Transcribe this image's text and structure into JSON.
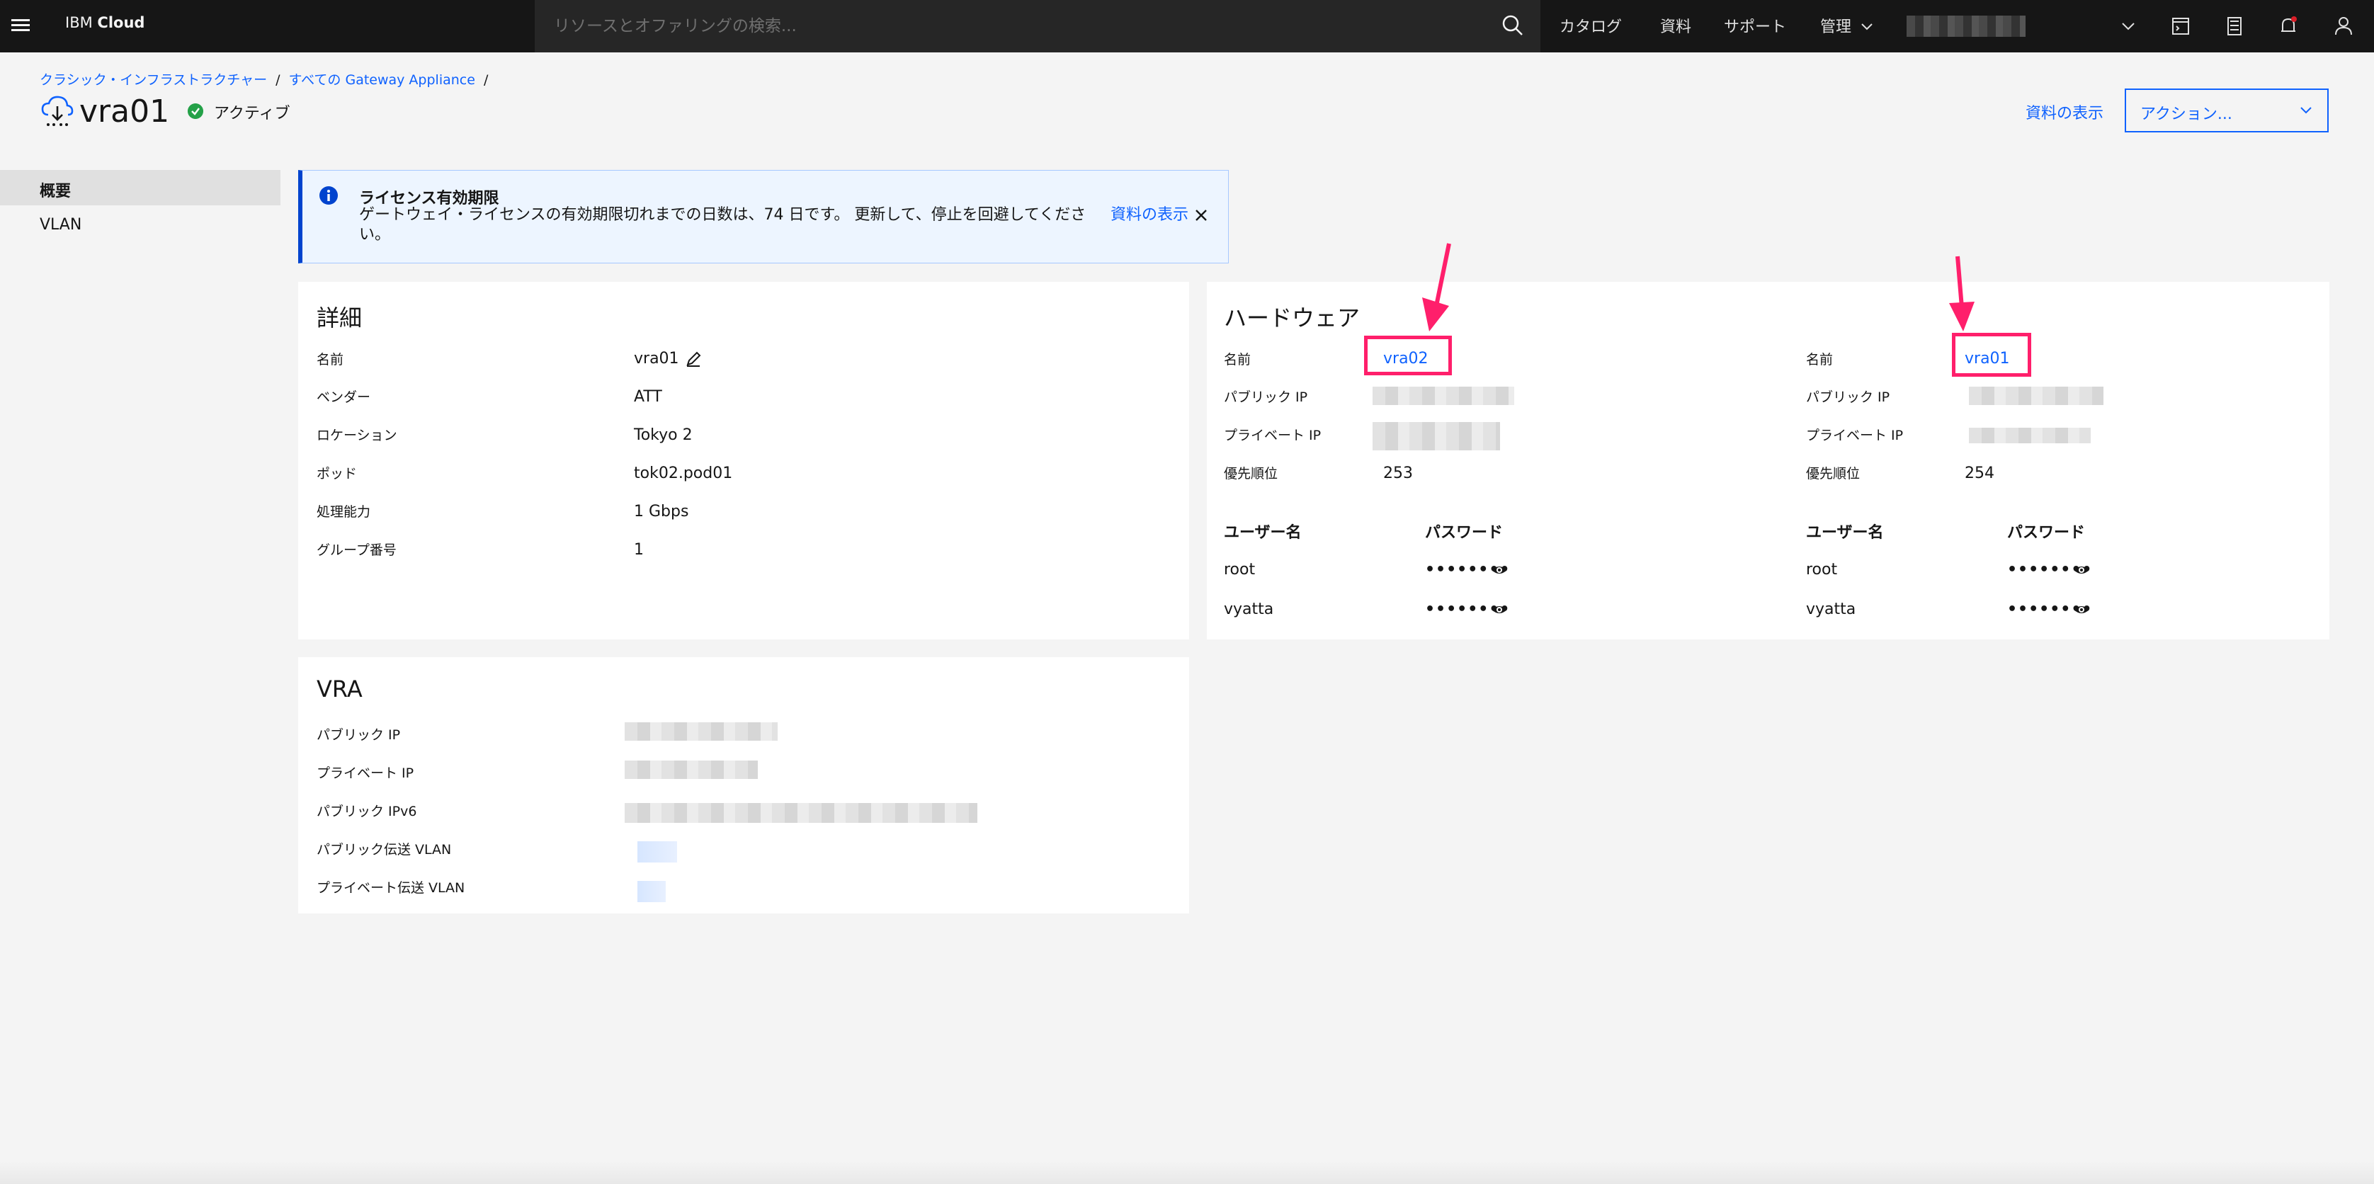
{
  "topbar": {
    "brand_prefix": "IBM",
    "brand_name": "Cloud",
    "search_placeholder": "リソースとオファリングの検索...",
    "nav": [
      "カタログ",
      "資料",
      "サポート",
      "管理"
    ]
  },
  "breadcrumb": {
    "items": [
      "クラシック・インフラストラクチャー",
      "すべての Gateway Appliance"
    ],
    "separator": "/"
  },
  "header": {
    "title": "vra01",
    "status": "アクティブ",
    "doc_link": "資料の表示",
    "actions_label": "アクション..."
  },
  "sidebar": {
    "items": [
      {
        "label": "概要",
        "active": true
      },
      {
        "label": "VLAN",
        "active": false
      }
    ]
  },
  "notification": {
    "title": "ライセンス有効期限",
    "text": "ゲートウェイ・ライセンスの有効期限切れまでの日数は、74 日です。 更新して、停止を回避してください。",
    "link": "資料の表示"
  },
  "details": {
    "heading": "詳細",
    "rows": [
      {
        "label": "名前",
        "value": "vra01"
      },
      {
        "label": "ベンダー",
        "value": "ATT"
      },
      {
        "label": "ロケーション",
        "value": "Tokyo 2"
      },
      {
        "label": "ポッド",
        "value": "tok02.pod01"
      },
      {
        "label": "処理能力",
        "value": "1 Gbps"
      },
      {
        "label": "グループ番号",
        "value": "1"
      }
    ]
  },
  "hardware": {
    "heading": "ハードウェア",
    "labels": {
      "name": "名前",
      "public_ip": "パブリック IP",
      "private_ip": "プライベート IP",
      "priority": "優先順位",
      "username": "ユーザー名",
      "password": "パスワード"
    },
    "members": [
      {
        "name": "vra02",
        "priority": "253",
        "users": [
          "root",
          "vyatta"
        ]
      },
      {
        "name": "vra01",
        "priority": "254",
        "users": [
          "root",
          "vyatta"
        ]
      }
    ],
    "masked_password": "••••••••"
  },
  "vra": {
    "heading": "VRA",
    "rows": [
      {
        "label": "パブリック IP"
      },
      {
        "label": "プライベート IP"
      },
      {
        "label": "パブリック IPv6"
      },
      {
        "label": "パブリック伝送 VLAN"
      },
      {
        "label": "プライベート伝送 VLAN"
      }
    ]
  },
  "colors": {
    "accent": "#0f62fe",
    "highlight": "#ff1f6b",
    "status_active": "#24a148",
    "topbar": "#161616"
  }
}
